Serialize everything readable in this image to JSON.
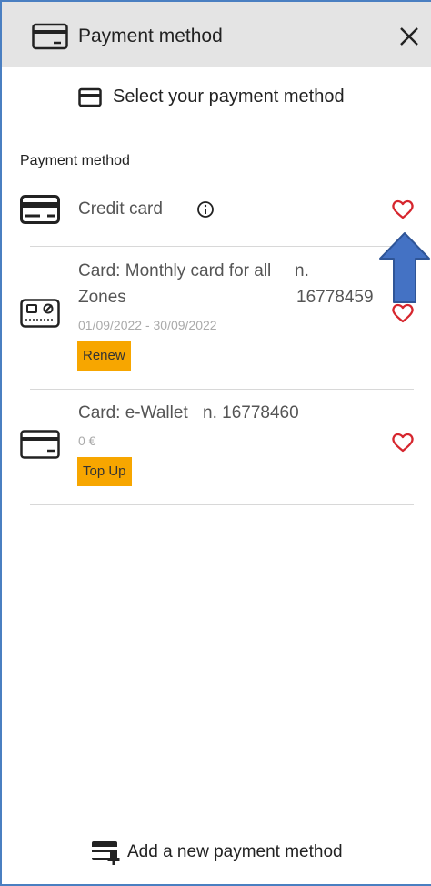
{
  "header": {
    "title": "Payment method",
    "icon": "credit-card-icon",
    "close_icon": "close-icon"
  },
  "select_prompt": {
    "text": "Select your payment method",
    "icon": "card-icon"
  },
  "section_label": "Payment method",
  "credit_card": {
    "label": "Credit card",
    "info_icon": "info-icon",
    "favorite_icon": "heart-outline-icon"
  },
  "cards": [
    {
      "name_line1": "Card: Monthly card for all",
      "name_line2": "Zones",
      "number_line1": "n.",
      "number_line2": "16778459",
      "subtitle": "01/09/2022 - 30/09/2022",
      "action_label": "Renew",
      "icon": "transit-card-icon"
    },
    {
      "name_line1": "Card: e-Wallet",
      "number_line1": "n. 16778460",
      "subtitle": "0 €",
      "action_label": "Top Up",
      "icon": "wallet-card-icon"
    }
  ],
  "add_method": {
    "label": "Add a new payment method",
    "icon": "add-card-icon"
  },
  "colors": {
    "header_bg": "#e4e4e4",
    "accent_button": "#f7a600",
    "heart": "#d6262e",
    "arrow": "#4472c4",
    "frame_border": "#4a7fc1"
  }
}
